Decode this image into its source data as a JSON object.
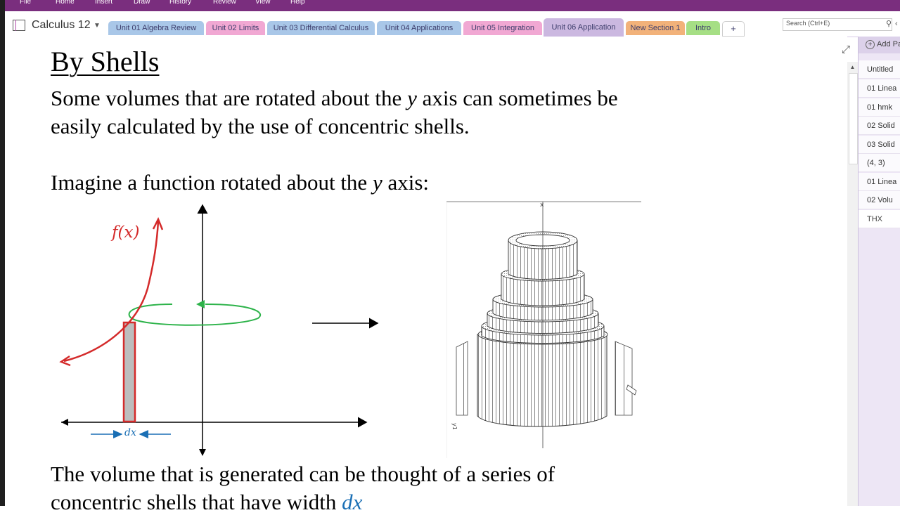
{
  "ribbon": {
    "menu": [
      {
        "label": "File"
      },
      {
        "label": "Home"
      },
      {
        "label": "Insert"
      },
      {
        "label": "Draw"
      },
      {
        "label": "History"
      },
      {
        "label": "Review"
      },
      {
        "label": "View"
      },
      {
        "label": "Help"
      }
    ]
  },
  "notebook": {
    "name": "Calculus 12"
  },
  "sections": [
    {
      "label": "Unit 01 Algebra Review",
      "color": "#a9c7e8"
    },
    {
      "label": "Unit 02 Limits",
      "color": "#f1a8d3"
    },
    {
      "label": "Unit 03 Differential Calculus",
      "color": "#a9c7e8"
    },
    {
      "label": "Unit 04 Applications",
      "color": "#a9c7e8"
    },
    {
      "label": "Unit 05 Integration",
      "color": "#f1a8d3"
    },
    {
      "label": "Unit 06 Application",
      "color": "#cbb8e0",
      "active": true
    },
    {
      "label": "New Section 1",
      "color": "#f2b27a"
    },
    {
      "label": "Intro",
      "color": "#a6df85"
    },
    {
      "label": "+",
      "color": "#ffffff"
    }
  ],
  "search": {
    "placeholder": "Search (Ctrl+E)"
  },
  "page": {
    "title": "By Shells",
    "para1_line1_a": "Some volumes that are rotated about the ",
    "para1_y": "y",
    "para1_line1_b": " axis can sometimes be",
    "para1_line2": "easily calculated by the use of concentric shells.",
    "para2_a": "Imagine a function rotated about the ",
    "para2_y": "y",
    "para2_b": " axis:",
    "para3_line1": "The volume that is generated can be thought of a series of",
    "para3_line2_a": "concentric shells that have width ",
    "para3_dx": "dx"
  },
  "diagram": {
    "function_label": "f(x)",
    "width_label": "dx"
  },
  "figure_marks": {
    "top": "x",
    "left": "y1"
  },
  "pages_pane": {
    "add_page": "Add Pa",
    "items": [
      {
        "label": "Untitled"
      },
      {
        "label": "01 Linea"
      },
      {
        "label": "01 hmk"
      },
      {
        "label": "02 Solid"
      },
      {
        "label": "03 Solid"
      },
      {
        "label": "(4, 3)"
      },
      {
        "label": "01 Linea"
      },
      {
        "label": "02 Volu"
      },
      {
        "label": "THX",
        "selected": true
      }
    ]
  },
  "colors": {
    "ribbon": "#7a2e7e",
    "curve": "#d42a2a",
    "rotation": "#2db34a",
    "dx": "#1a6fb5"
  }
}
